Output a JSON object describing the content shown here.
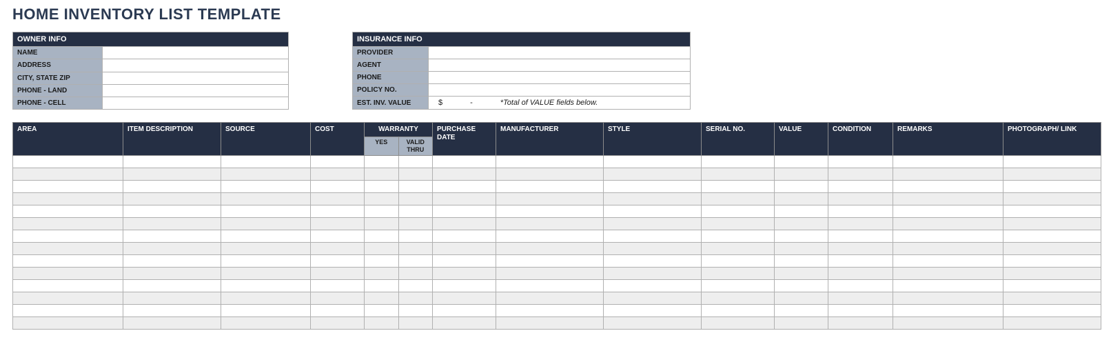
{
  "title": "HOME INVENTORY LIST TEMPLATE",
  "owner": {
    "header": "OWNER INFO",
    "fields": {
      "name_label": "NAME",
      "name_value": "",
      "address_label": "ADDRESS",
      "address_value": "",
      "csz_label": "CITY, STATE ZIP",
      "csz_value": "",
      "phone_land_label": "PHONE - LAND",
      "phone_land_value": "",
      "phone_cell_label": "PHONE - CELL",
      "phone_cell_value": ""
    }
  },
  "insurance": {
    "header": "INSURANCE INFO",
    "fields": {
      "provider_label": "PROVIDER",
      "provider_value": "",
      "agent_label": "AGENT",
      "agent_value": "",
      "phone_label": "PHONE",
      "phone_value": "",
      "policy_label": "POLICY NO.",
      "policy_value": "",
      "est_label": "EST. INV. VALUE",
      "est_currency": "$",
      "est_value": "-",
      "est_note": "*Total of VALUE fields below."
    }
  },
  "columns": {
    "area": "AREA",
    "item": "ITEM DESCRIPTION",
    "source": "SOURCE",
    "cost": "COST",
    "warranty": "WARRANTY",
    "warranty_yes": "YES",
    "warranty_thru": "VALID THRU",
    "purchase_date": "PURCHASE DATE",
    "manufacturer": "MANUFACTURER",
    "style": "STYLE",
    "serial": "SERIAL NO.",
    "value": "VALUE",
    "condition": "CONDITION",
    "remarks": "REMARKS",
    "photo": "PHOTOGRAPH/ LINK"
  },
  "rows": [
    {},
    {},
    {},
    {},
    {},
    {},
    {},
    {},
    {},
    {},
    {},
    {},
    {},
    {}
  ]
}
